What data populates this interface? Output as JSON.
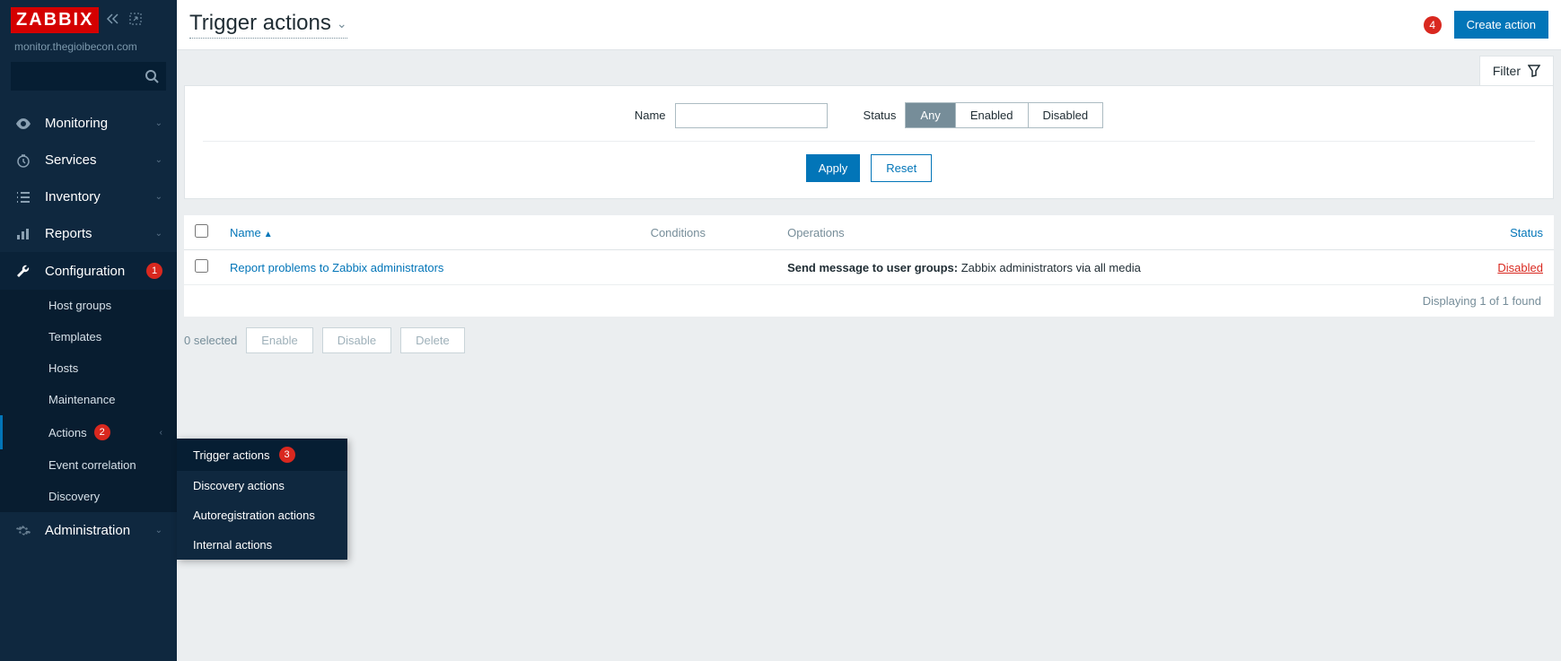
{
  "logo": "ZABBIX",
  "host": "monitor.thegioibecon.com",
  "nav": {
    "monitoring": "Monitoring",
    "services": "Services",
    "inventory": "Inventory",
    "reports": "Reports",
    "configuration": "Configuration",
    "administration": "Administration"
  },
  "config_badge": "1",
  "config_sub": {
    "host_groups": "Host groups",
    "templates": "Templates",
    "hosts": "Hosts",
    "maintenance": "Maintenance",
    "actions": "Actions",
    "actions_badge": "2",
    "event_correlation": "Event correlation",
    "discovery": "Discovery"
  },
  "flyout": {
    "trigger": "Trigger actions",
    "trigger_badge": "3",
    "discovery": "Discovery actions",
    "autoreg": "Autoregistration actions",
    "internal": "Internal actions"
  },
  "header": {
    "title": "Trigger actions",
    "badge": "4",
    "create": "Create action"
  },
  "filter": {
    "toggle": "Filter",
    "name_label": "Name",
    "name_value": "",
    "status_label": "Status",
    "status_any": "Any",
    "status_enabled": "Enabled",
    "status_disabled": "Disabled",
    "apply": "Apply",
    "reset": "Reset"
  },
  "table": {
    "col_name": "Name",
    "col_conditions": "Conditions",
    "col_operations": "Operations",
    "col_status": "Status",
    "rows": [
      {
        "name": "Report problems to Zabbix administrators",
        "conditions": "",
        "op_prefix": "Send message to user groups:",
        "op_rest": " Zabbix administrators via all media",
        "status": "Disabled"
      }
    ],
    "footer": "Displaying 1 of 1 found"
  },
  "mass": {
    "selected": "0 selected",
    "enable": "Enable",
    "disable": "Disable",
    "delete": "Delete"
  }
}
